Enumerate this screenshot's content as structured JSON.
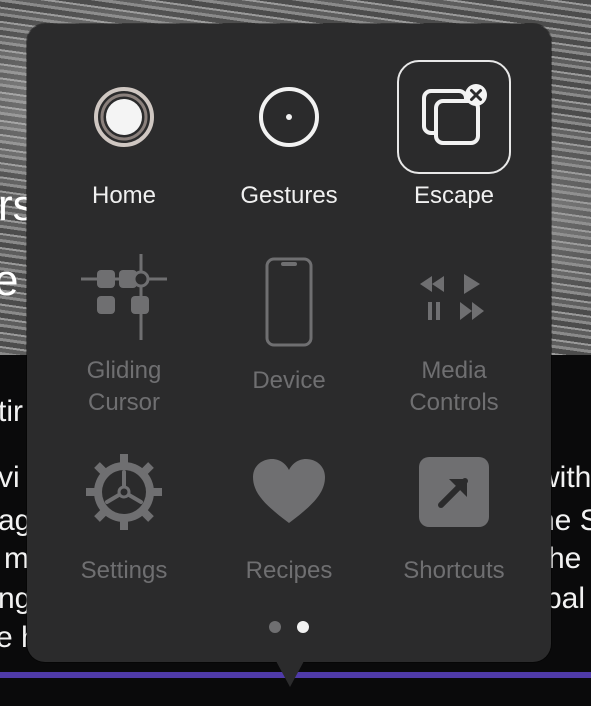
{
  "background": {
    "fragments": [
      "rs",
      "e F",
      "tir",
      "vi",
      "ag",
      "m",
      "ng",
      "e h",
      "with",
      "he S",
      "he",
      "bal"
    ]
  },
  "menu": {
    "items": [
      {
        "label": "Home",
        "icon": "home-icon",
        "enabled": true
      },
      {
        "label": "Gestures",
        "icon": "gestures-icon",
        "enabled": true
      },
      {
        "label": "Escape",
        "icon": "escape-icon",
        "enabled": true
      },
      {
        "label": "Gliding\nCursor",
        "icon": "gliding-cursor-icon",
        "enabled": false
      },
      {
        "label": "Device",
        "icon": "device-icon",
        "enabled": false
      },
      {
        "label": "Media\nControls",
        "icon": "media-controls-icon",
        "enabled": false
      },
      {
        "label": "Settings",
        "icon": "settings-gear-icon",
        "enabled": false
      },
      {
        "label": "Recipes",
        "icon": "heart-icon",
        "enabled": false
      },
      {
        "label": "Shortcuts",
        "icon": "shortcuts-arrow-icon",
        "enabled": false
      }
    ],
    "page_indicator": {
      "pages": 2,
      "current": 2
    }
  },
  "colors": {
    "panel": "#2b2b2c",
    "enabled_text": "#f0f0f0",
    "disabled_text": "#6f6f71",
    "accent_line": "#4f3aa8"
  }
}
